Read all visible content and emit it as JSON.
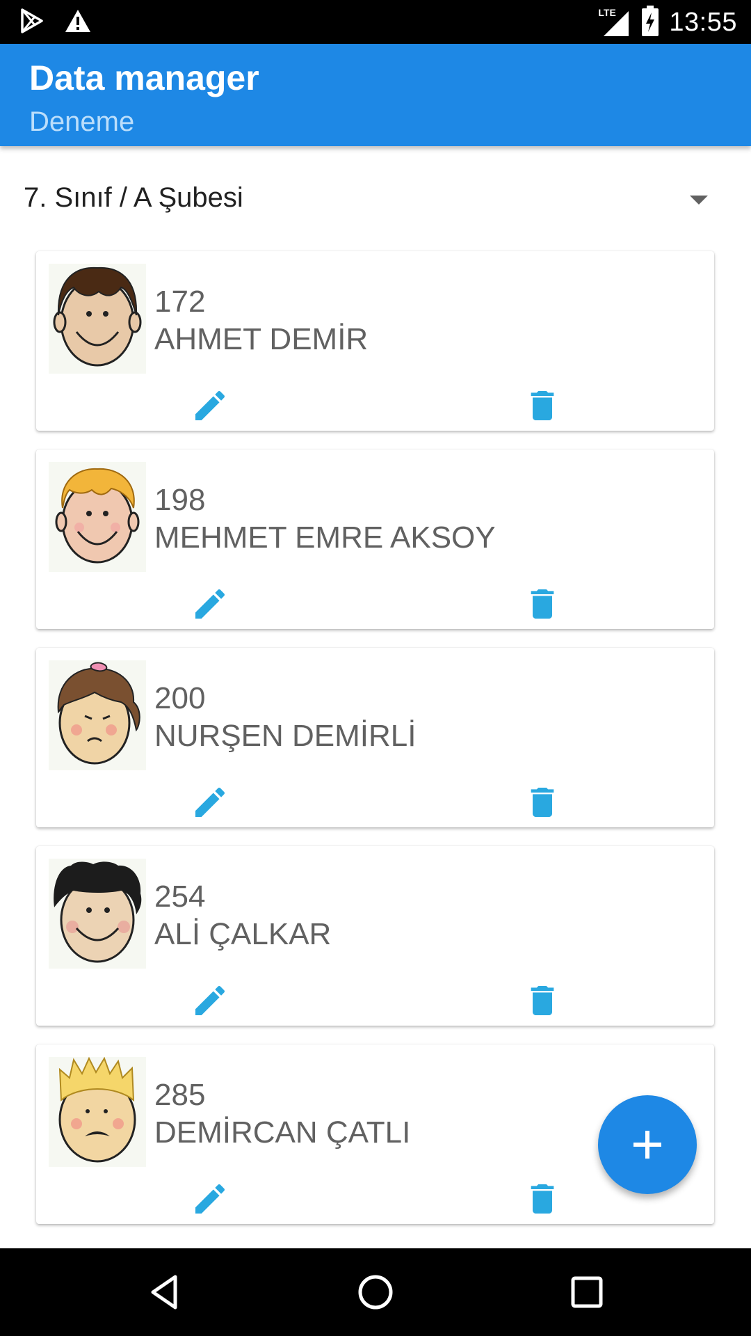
{
  "status_bar": {
    "time": "13:55",
    "network_label": "LTE",
    "icons": [
      "play-store-icon",
      "warning-icon",
      "lte-signal-icon",
      "battery-charging-icon"
    ]
  },
  "app_bar": {
    "title": "Data manager",
    "subtitle": "Deneme"
  },
  "class_selector": {
    "selected": "7. Sınıf / A Şubesi"
  },
  "students": [
    {
      "number": "172",
      "name": "AHMET DEMİR"
    },
    {
      "number": "198",
      "name": "MEHMET EMRE AKSOY"
    },
    {
      "number": "200",
      "name": "NURŞEN DEMİRLİ"
    },
    {
      "number": "254",
      "name": "ALİ ÇALKAR"
    },
    {
      "number": "285",
      "name": "DEMİRCAN ÇATLI"
    }
  ],
  "colors": {
    "primary": "#1e88e5",
    "accent_icon": "#29a8e0",
    "text_secondary": "#616161"
  },
  "fab": {
    "icon": "plus-icon"
  },
  "nav_bar": {
    "icons": [
      "back-icon",
      "home-icon",
      "recents-icon"
    ]
  }
}
